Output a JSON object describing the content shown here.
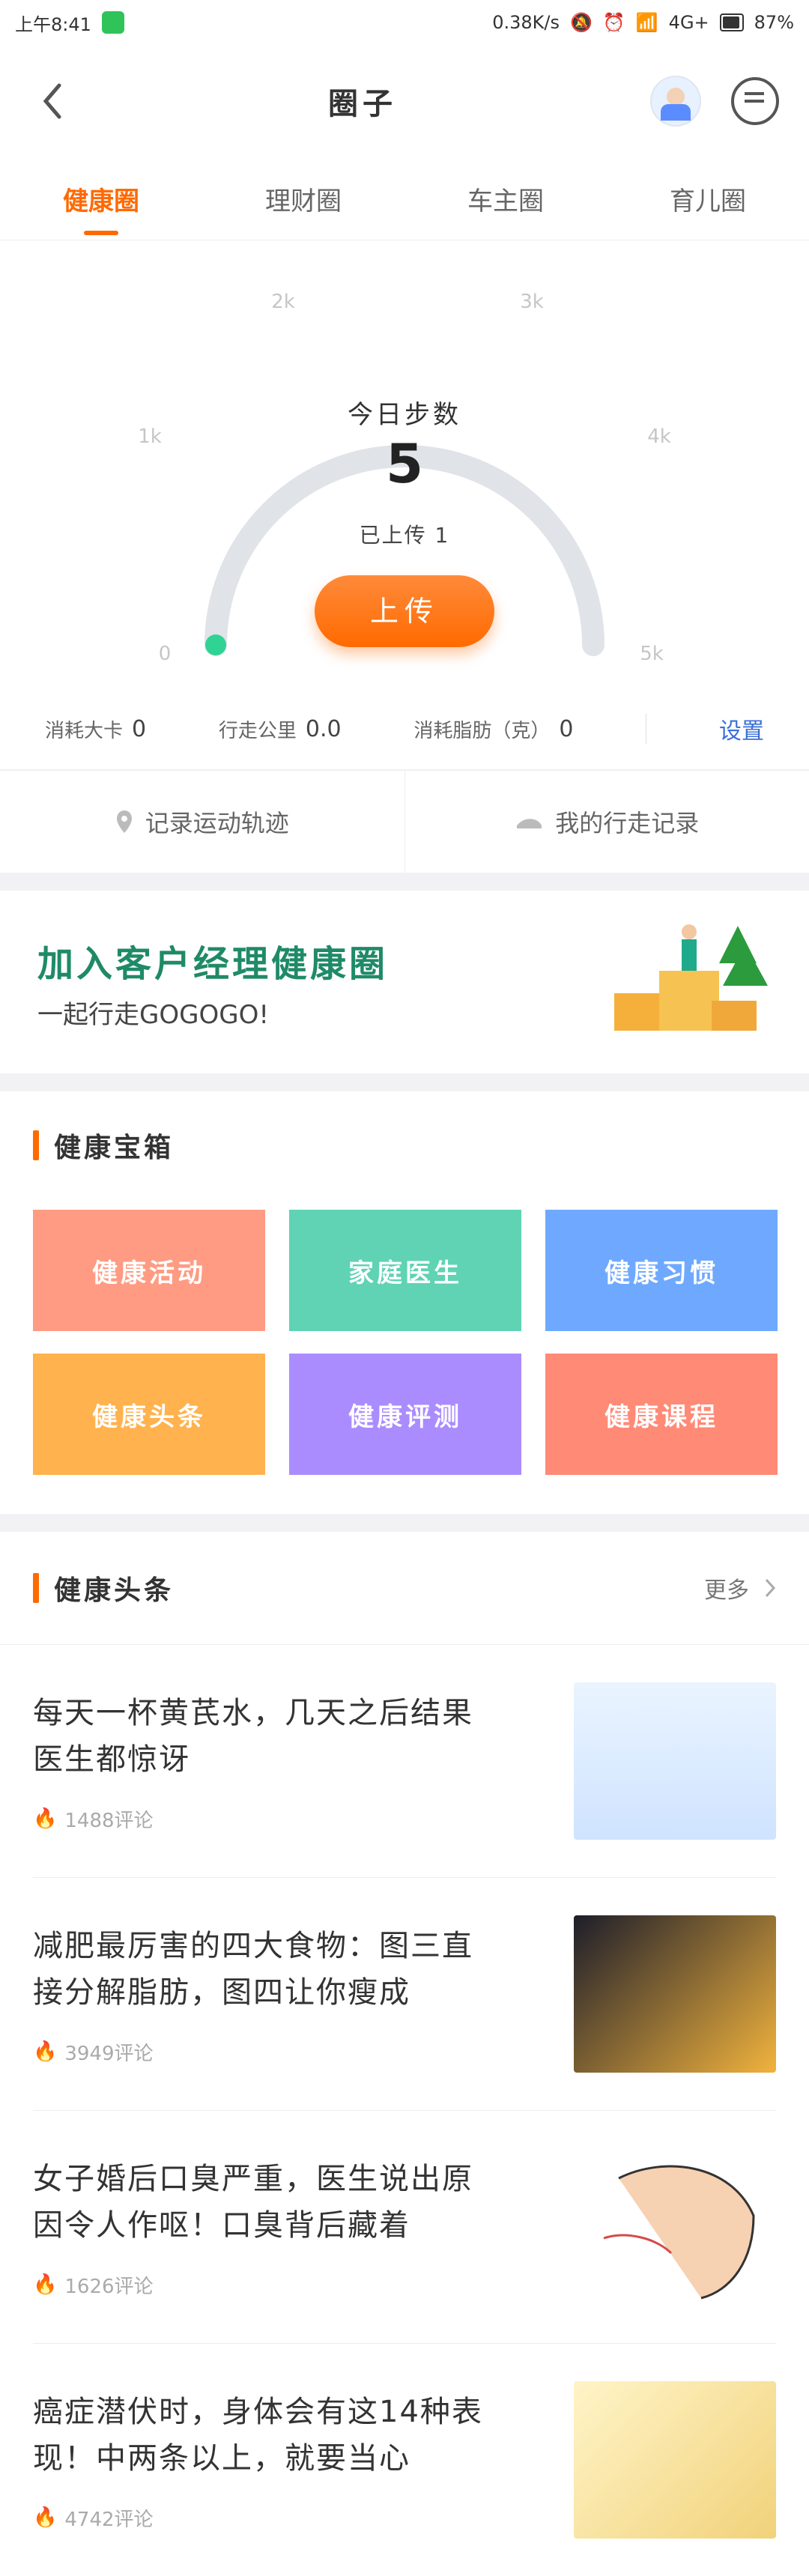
{
  "statusbar": {
    "time": "上午8:41",
    "speed": "0.38K/s",
    "network": "4G+",
    "battery": "87%"
  },
  "navbar": {
    "title": "圈子"
  },
  "tabs": [
    "健康圈",
    "理财圈",
    "车主圈",
    "育儿圈"
  ],
  "steps": {
    "today_label": "今日步数",
    "today_value": "5",
    "uploaded_text": "已上传 1",
    "upload_button": "上传",
    "gauge": {
      "labels": [
        "0",
        "1k",
        "2k",
        "3k",
        "4k",
        "5k"
      ],
      "fill_fraction": 0.001
    },
    "metrics": [
      {
        "label": "消耗大卡",
        "value": "0"
      },
      {
        "label": "行走公里",
        "value": "0.0"
      },
      {
        "label": "消耗脂肪（克）",
        "value": "0"
      }
    ],
    "setting_label": "设置"
  },
  "actions": [
    {
      "label": "记录运动轨迹",
      "icon": "location-pin-icon"
    },
    {
      "label": "我的行走记录",
      "icon": "shoe-icon"
    }
  ],
  "banner": {
    "title": "加入客户经理健康圈",
    "subtitle": "一起行走GOGOGO!"
  },
  "treasure": {
    "title": "健康宝箱",
    "items": [
      {
        "label": "健康活动",
        "color": "#ff9b82"
      },
      {
        "label": "家庭医生",
        "color": "#5fd3b3"
      },
      {
        "label": "健康习惯",
        "color": "#6ea9ff"
      },
      {
        "label": "健康头条",
        "color": "#ffb24d"
      },
      {
        "label": "健康评测",
        "color": "#aa8cff"
      },
      {
        "label": "健康课程",
        "color": "#ff8a76"
      }
    ]
  },
  "news": {
    "title": "健康头条",
    "more": "更多",
    "items": [
      {
        "title": "每天一杯黄芪水，几天之后结果医生都惊讶",
        "comments": "1488评论"
      },
      {
        "title": "减肥最厉害的四大食物：图三直接分解脂肪，图四让你瘦成",
        "comments": "3949评论"
      },
      {
        "title": "女子婚后口臭严重，医生说出原因令人作呕！口臭背后藏着",
        "comments": "1626评论"
      },
      {
        "title": "癌症潜伏时，身体会有这14种表现！中两条以上，就要当心",
        "comments": "4742评论"
      }
    ]
  }
}
